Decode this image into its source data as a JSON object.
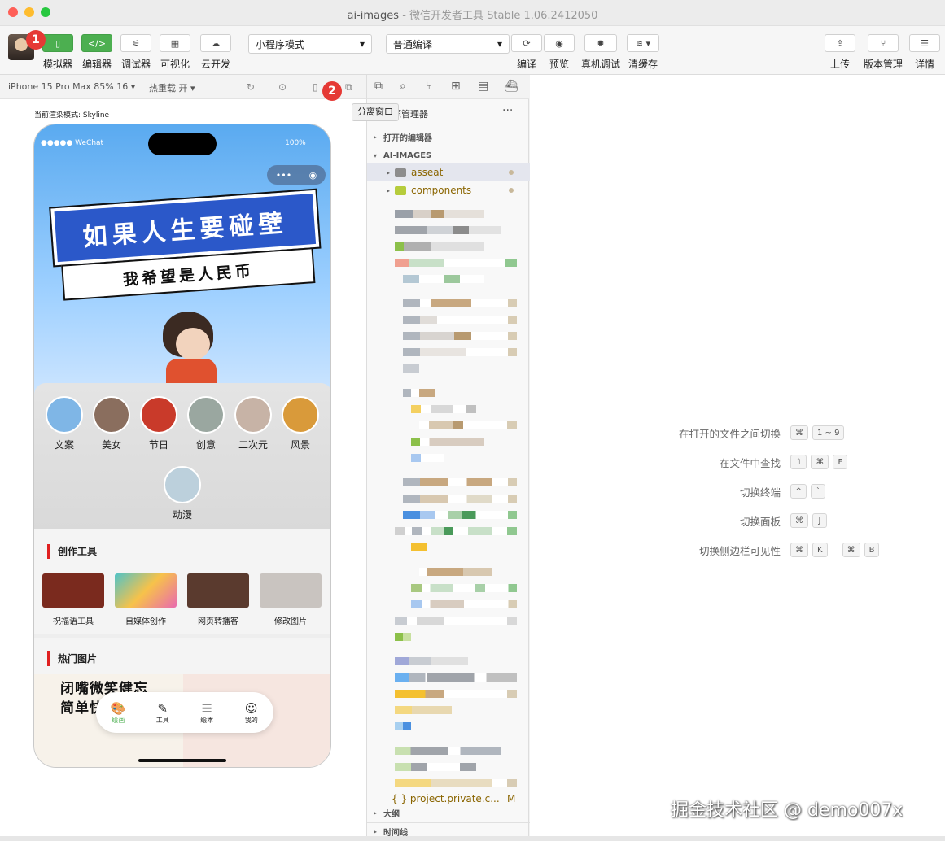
{
  "window": {
    "title": "ai-images",
    "subtitle": " - 微信开发者工具 Stable 1.06.2412050"
  },
  "toolbar": {
    "simulator": "模拟器",
    "editor": "编辑器",
    "debugger": "调试器",
    "visual": "可视化",
    "cloud": "云开发",
    "mode_select": "小程序模式",
    "compile_select": "普通编译",
    "compile": "编译",
    "preview": "预览",
    "real_debug": "真机调试",
    "clear_cache": "清缓存",
    "upload": "上传",
    "version": "版本管理",
    "details": "详情",
    "editor_icon_text": "</>"
  },
  "badges": [
    "1",
    "2"
  ],
  "simulator": {
    "device": "iPhone 15 Pro Max 85% 16 ▾",
    "hot_reload": "热重载 开 ▾",
    "render_mode": "当前渲染模式: Skyline"
  },
  "phone": {
    "status_left": "●●●●● WeChat",
    "status_right": "100%",
    "capsule_dots": "•••",
    "capsule_target": "◉",
    "sign_top": "如果人生要碰壁",
    "sign_bottom": "我希望是人民币",
    "categories": [
      {
        "label": "文案",
        "color": "#7fb6e6"
      },
      {
        "label": "美女",
        "color": "#8a6e5e"
      },
      {
        "label": "节日",
        "color": "#c93a2a"
      },
      {
        "label": "创意",
        "color": "#9aa7a0"
      },
      {
        "label": "二次元",
        "color": "#c7b3a6"
      },
      {
        "label": "风景",
        "color": "#d99a3a"
      },
      {
        "label": "动漫",
        "color": "#bcd0dc"
      }
    ],
    "tools_title": "创作工具",
    "tools": [
      {
        "label": "祝福语工具",
        "color": "#7a2a1e"
      },
      {
        "label": "自媒体创作",
        "color": "#4fc3c8"
      },
      {
        "label": "网页转播客",
        "color": "#5a3a2e"
      },
      {
        "label": "修改图片",
        "color": "#c9c4c0"
      }
    ],
    "hot_title": "热门图片",
    "hot_text_1": "闭嘴微笑健忘",
    "hot_text_2": "简单快乐",
    "tabs": [
      {
        "label": "绘画",
        "icon": "🎨",
        "active": true
      },
      {
        "label": "工具",
        "icon": "✎",
        "active": false
      },
      {
        "label": "绘本",
        "icon": "☰",
        "active": false
      },
      {
        "label": "我的",
        "icon": "☺",
        "active": false
      }
    ]
  },
  "explorer": {
    "title": "资源管理器",
    "tooltip": "分离窗口",
    "open_editors": "打开的编辑器",
    "project": "AI-IMAGES",
    "folder_asseat": "asseat",
    "folder_components": "components",
    "file_private": "{ } project.private.c...",
    "file_private_status": "M",
    "outline": "大纲",
    "timeline": "时间线",
    "more": "···"
  },
  "hints": [
    {
      "name": "在打开的文件之间切换",
      "keys": [
        "⌘",
        "1 ~ 9"
      ]
    },
    {
      "name": "在文件中查找",
      "keys": [
        "⇧",
        "⌘",
        "F"
      ]
    },
    {
      "name": "切换终端",
      "keys": [
        "^",
        "`"
      ]
    },
    {
      "name": "切换面板",
      "keys": [
        "⌘",
        "J"
      ]
    },
    {
      "name": "切换侧边栏可见性",
      "keys": [
        "⌘",
        "K",
        "|",
        "⌘",
        "B"
      ]
    }
  ],
  "watermark": "掘金技术社区 @ demo007x"
}
